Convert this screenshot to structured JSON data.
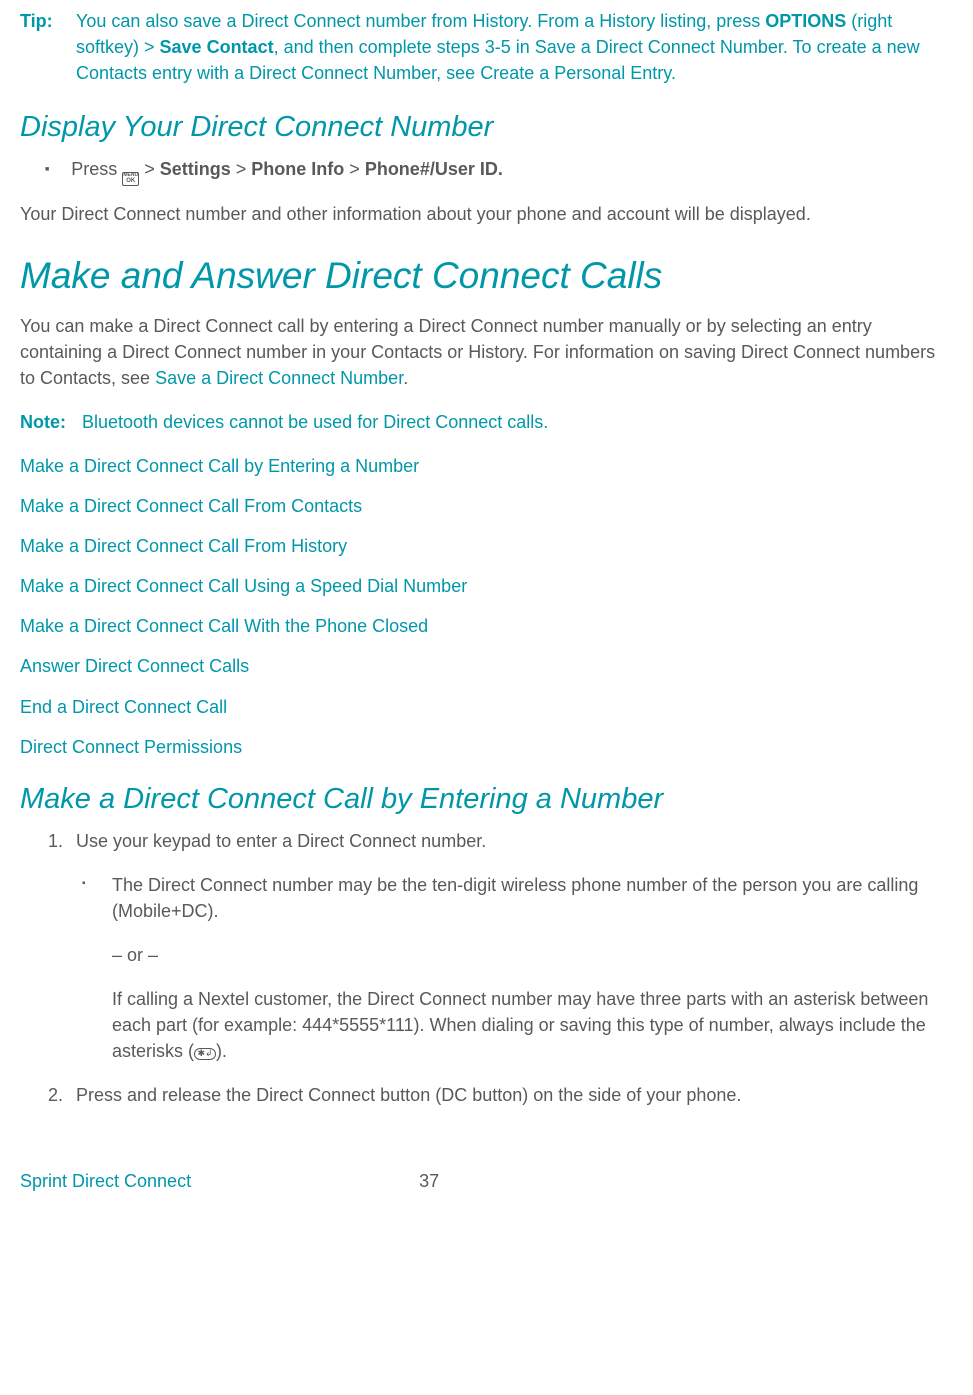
{
  "tip": {
    "label": "Tip:",
    "text1": "You can also save a Direct Connect number from History. From a History listing, press ",
    "options": "OPTIONS",
    "text2": " (right softkey) > ",
    "save_contact": "Save Contact",
    "text3": ", and then complete steps 3-5 in ",
    "link1": "Save a Direct Connect Number",
    "text4": ". To create a new Contacts entry with a Direct Connect Number, see ",
    "link2": "Create a Personal Entry",
    "text5": "."
  },
  "display_heading": "Display Your Direct Connect Number",
  "display_bullet": {
    "press": "Press ",
    "gt1": " > ",
    "settings": "Settings",
    "gt2": " > ",
    "phone_info": "Phone Info",
    "gt3": " > ",
    "phone_user": "Phone#/User ID."
  },
  "display_para": "Your Direct Connect number and other information about your phone and account will be displayed.",
  "make_answer_heading": "Make and Answer Direct Connect Calls",
  "make_answer_para1": "You can make a Direct Connect call by entering a Direct Connect number manually or by selecting an entry containing a Direct Connect number in your Contacts or History. For information on saving Direct Connect numbers to Contacts, see ",
  "make_answer_link": "Save a Direct Connect Number",
  "make_answer_period": ".",
  "note": {
    "label": "Note:",
    "text": "Bluetooth devices cannot be used for Direct Connect calls."
  },
  "links": [
    "Make a Direct Connect Call by Entering a Number",
    "Make a Direct Connect Call From Contacts",
    "Make a Direct Connect Call From History",
    "Make a Direct Connect Call Using a Speed Dial Number",
    "Make a Direct Connect Call With the Phone Closed",
    "Answer Direct Connect Calls",
    "End a Direct Connect Call",
    "Direct Connect Permissions"
  ],
  "make_call_heading": "Make a Direct Connect Call by Entering a Number",
  "step1": {
    "num": "1.",
    "text": "Use your keypad to enter a Direct Connect number."
  },
  "sub_bullet_text": "The Direct Connect number may be the ten-digit wireless phone number of the person you are calling (Mobile+DC).",
  "or_text": "– or –",
  "nextel_text1": "If calling a Nextel customer, the Direct Connect number may have three parts with an asterisk between each part (for example: 444*5555*111). When dialing or saving this type of number, always include the asterisks (",
  "nextel_text2": ").",
  "step2": {
    "num": "2.",
    "text": "Press and release the Direct Connect button (DC button) on the side of your phone."
  },
  "footer": {
    "section": "Sprint Direct Connect",
    "page": "37"
  }
}
